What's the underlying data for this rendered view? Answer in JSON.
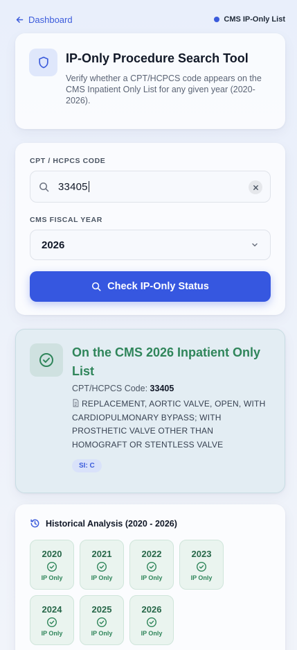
{
  "nav": {
    "back_label": "Dashboard",
    "status_label": "CMS IP-Only List"
  },
  "header": {
    "title": "IP-Only Procedure Search Tool",
    "subtitle": "Verify whether a CPT/HCPCS code appears on the CMS Inpatient Only List for any given year (2020-2026)."
  },
  "form": {
    "code_label": "CPT / HCPCS CODE",
    "code_value": "33405",
    "year_label": "CMS FISCAL YEAR",
    "year_value": "2026",
    "submit_label": "Check IP-Only Status"
  },
  "result": {
    "title": "On the CMS 2026 Inpatient Only List",
    "code_prefix": "CPT/HCPCS Code:",
    "code": "33405",
    "description": "REPLACEMENT, AORTIC VALVE, OPEN, WITH CARDIOPULMONARY BYPASS; WITH PROSTHETIC VALVE OTHER THAN HOMOGRAFT OR STENTLESS VALVE",
    "badge": "SI: C"
  },
  "history": {
    "title": "Historical Analysis (2020 - 2026)",
    "years": [
      {
        "year": "2020",
        "status": "IP Only"
      },
      {
        "year": "2021",
        "status": "IP Only"
      },
      {
        "year": "2022",
        "status": "IP Only"
      },
      {
        "year": "2023",
        "status": "IP Only"
      },
      {
        "year": "2024",
        "status": "IP Only"
      },
      {
        "year": "2025",
        "status": "IP Only"
      },
      {
        "year": "2026",
        "status": "IP Only"
      }
    ]
  },
  "colors": {
    "accent": "#3657e0",
    "success": "#2f855a",
    "success_bg": "#eaf4ef"
  }
}
